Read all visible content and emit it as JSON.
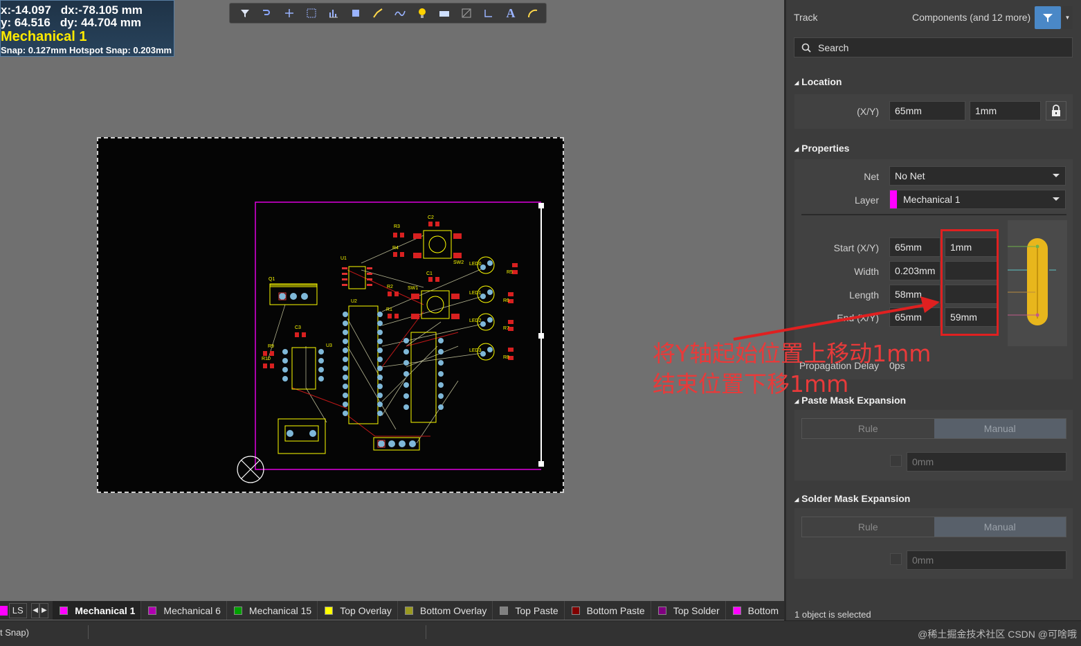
{
  "hud": {
    "x": "x:-14.097",
    "dx": "dx:-78.105 mm",
    "y": "y: 64.516",
    "dy": "dy: 44.704 mm",
    "layer": "Mechanical 1",
    "snap": "Snap: 0.127mm Hotspot Snap: 0.203mm"
  },
  "toolbar": {
    "icons": [
      "filter-icon",
      "route-icon",
      "cross-icon",
      "select-rect-icon",
      "chart-icon",
      "component-icon",
      "interactive-route-icon",
      "diff-pair-icon",
      "bulb-icon",
      "fill-icon",
      "polygon-icon",
      "dimension-icon",
      "text-icon",
      "arc-icon"
    ]
  },
  "board": {
    "designators": [
      "R3",
      "C2",
      "R4",
      "U1",
      "SW2",
      "Q1",
      "C1",
      "R2",
      "SW1",
      "R1",
      "C3",
      "R9",
      "R10",
      "U3",
      "U2",
      "LED0",
      "LED1",
      "LED2",
      "LED3",
      "R5",
      "R6",
      "R7",
      "R8"
    ]
  },
  "layer_bar": {
    "ls_label": "LS",
    "tabs": [
      {
        "label": "Mechanical 1",
        "color": "#ff00ff",
        "active": true
      },
      {
        "label": "Mechanical 6",
        "color": "#b000b0",
        "active": false
      },
      {
        "label": "Mechanical 15",
        "color": "#00a000",
        "active": false
      },
      {
        "label": "Top Overlay",
        "color": "#ffff00",
        "active": false
      },
      {
        "label": "Bottom Overlay",
        "color": "#9a9a20",
        "active": false
      },
      {
        "label": "Top Paste",
        "color": "#808080",
        "active": false
      },
      {
        "label": "Bottom Paste",
        "color": "#800000",
        "active": false
      },
      {
        "label": "Top Solder",
        "color": "#800080",
        "active": false
      },
      {
        "label": "Bottom",
        "color": "#ff00ff",
        "active": false
      }
    ]
  },
  "status_bar": {
    "left_text": "t Snap)",
    "watermark": "@稀土掘金技术社区 CSDN @可啥哦"
  },
  "panel": {
    "object_type": "Track",
    "filter_text": "Components (and 12 more)",
    "search_placeholder": "Search",
    "location": {
      "title": "Location",
      "xy_label": "(X/Y)",
      "x": "65mm",
      "y": "1mm"
    },
    "properties": {
      "title": "Properties",
      "net_label": "Net",
      "net_value": "No Net",
      "layer_label": "Layer",
      "layer_value": "Mechanical 1",
      "layer_color": "#ff00ff",
      "start_label": "Start (X/Y)",
      "start_x": "65mm",
      "start_y": "1mm",
      "width_label": "Width",
      "width_value": "0.203mm",
      "length_label": "Length",
      "length_value": "58mm",
      "end_label": "End (X/Y)",
      "end_x": "65mm",
      "end_y": "59mm",
      "prop_delay_label": "Propagation Delay",
      "prop_delay_value": "0ps"
    },
    "paste_mask": {
      "title": "Paste Mask Expansion",
      "rule": "Rule",
      "manual": "Manual",
      "value": "0mm"
    },
    "solder_mask": {
      "title": "Solder Mask Expansion",
      "rule": "Rule",
      "manual": "Manual",
      "value": "0mm"
    },
    "selection_status": "1 object is selected"
  },
  "annotation": {
    "line1": "将Y轴起始位置上移动1mm",
    "line2": "结束位置下移1mm",
    "color": "#e83a3a"
  }
}
